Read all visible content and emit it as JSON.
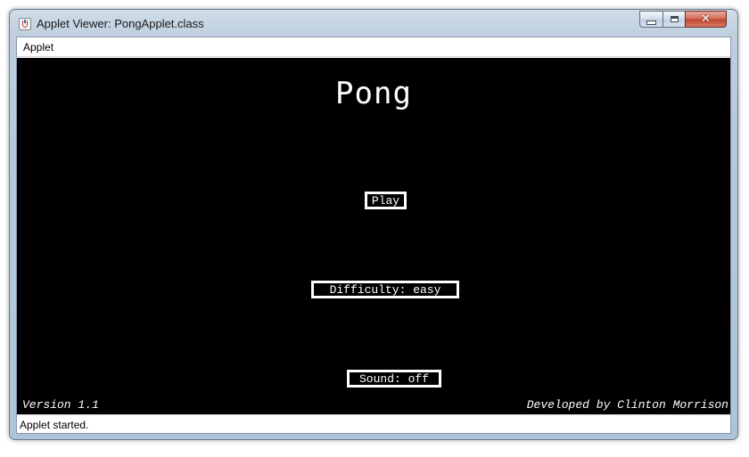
{
  "window": {
    "title": "Applet Viewer: PongApplet.class",
    "icon": "java-applet-icon",
    "controls": {
      "minimize_icon": "minimize-icon",
      "maximize_icon": "maximize-icon",
      "close_glyph": "✕"
    }
  },
  "menubar": {
    "items": [
      {
        "label": "Applet"
      }
    ]
  },
  "game": {
    "title": "Pong",
    "buttons": {
      "play": "Play",
      "difficulty": "Difficulty: easy",
      "sound": "Sound: off"
    },
    "version": "Version 1.1",
    "credit": "Developed by Clinton Morrison"
  },
  "status": {
    "text": "Applet started."
  },
  "colors": {
    "canvas_bg": "#000000",
    "foreground": "#ffffff",
    "close_button": "#c0432d"
  }
}
